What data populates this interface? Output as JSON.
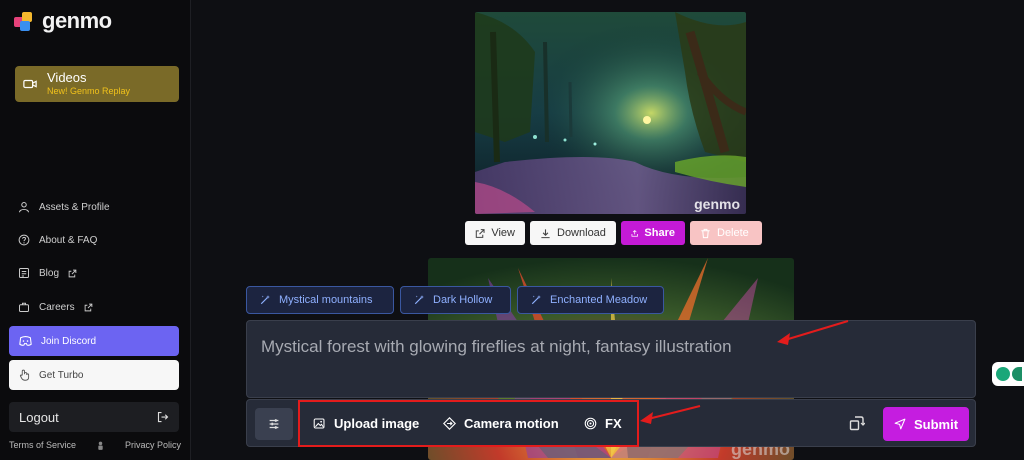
{
  "brand": {
    "name": "genmo"
  },
  "sidebar": {
    "videos": {
      "title": "Videos",
      "subtitle": "New! Genmo Replay"
    },
    "items": [
      {
        "label": "Assets & Profile",
        "icon": "user-icon"
      },
      {
        "label": "About & FAQ",
        "icon": "question-icon"
      },
      {
        "label": "Blog",
        "icon": "blog-icon",
        "external": true
      },
      {
        "label": "Careers",
        "icon": "careers-icon",
        "external": true
      }
    ],
    "discord_label": "Join Discord",
    "turbo_label": "Get Turbo",
    "logout_label": "Logout",
    "footer": {
      "terms": "Terms of Service",
      "privacy": "Privacy Policy"
    }
  },
  "image": {
    "watermark": "genmo"
  },
  "actions": {
    "view": "View",
    "download": "Download",
    "share": "Share",
    "delete": "Delete"
  },
  "background_image": {
    "watermark": "genmo"
  },
  "suggestions": [
    "Mystical mountains",
    "Dark Hollow",
    "Enchanted Meadow"
  ],
  "prompt": {
    "text": "Mystical forest with glowing fireflies at night, fantasy illustration"
  },
  "toolbar": {
    "upload_label": "Upload image",
    "camera_label": "Camera motion",
    "fx_label": "FX",
    "submit_label": "Submit"
  },
  "colors": {
    "accent": "#c51de0",
    "discord": "#6c64f2",
    "videos_bg": "#7a6a28",
    "annotation": "#e31c1c",
    "chip_text": "#8fb0ff"
  }
}
